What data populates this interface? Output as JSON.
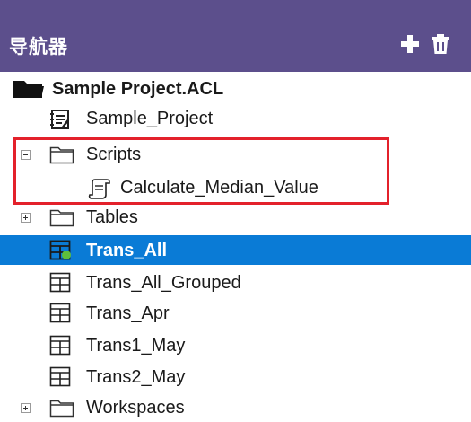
{
  "navigator": {
    "title": "导航器",
    "add_icon": "plus-icon",
    "delete_icon": "trash-icon"
  },
  "tree": {
    "project": "Sample Project.ACL",
    "items": [
      {
        "label": "Sample_Project",
        "icon": "log-notebook-icon"
      },
      {
        "label": "Scripts",
        "icon": "folder-icon",
        "expander": "minus"
      },
      {
        "label": "Calculate_Median_Value",
        "icon": "script-icon"
      },
      {
        "label": "Tables",
        "icon": "folder-icon",
        "expander": "plus"
      },
      {
        "label": "Trans_All",
        "icon": "table-active-icon",
        "selected": true
      },
      {
        "label": "Trans_All_Grouped",
        "icon": "table-icon"
      },
      {
        "label": "Trans_Apr",
        "icon": "table-icon"
      },
      {
        "label": "Trans1_May",
        "icon": "table-icon"
      },
      {
        "label": "Trans2_May",
        "icon": "table-icon"
      },
      {
        "label": "Workspaces",
        "icon": "folder-icon",
        "expander": "plus"
      }
    ]
  },
  "colors": {
    "header_bg": "#5c4f8c",
    "selection_bg": "#0a7bd6",
    "highlight_border": "#e3212b"
  }
}
